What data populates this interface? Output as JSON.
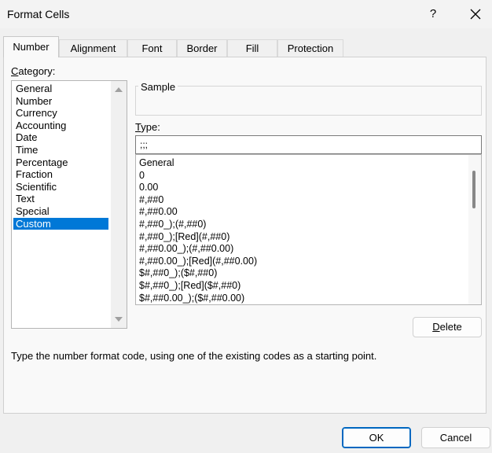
{
  "dialog": {
    "title": "Format Cells",
    "help_label": "?",
    "close_icon": "close-icon"
  },
  "tabs": [
    {
      "label": "Number",
      "active": true
    },
    {
      "label": "Alignment",
      "active": false
    },
    {
      "label": "Font",
      "active": false
    },
    {
      "label": "Border",
      "active": false
    },
    {
      "label": "Fill",
      "active": false
    },
    {
      "label": "Protection",
      "active": false
    }
  ],
  "category": {
    "label_prefix": "C",
    "label_rest": "ategory:",
    "items": [
      "General",
      "Number",
      "Currency",
      "Accounting",
      "Date",
      "Time",
      "Percentage",
      "Fraction",
      "Scientific",
      "Text",
      "Special",
      "Custom"
    ],
    "selected": "Custom"
  },
  "sample": {
    "label": "Sample",
    "value": ""
  },
  "type": {
    "label_prefix": "T",
    "label_rest": "ype:",
    "value": ";;;",
    "formats": [
      "General",
      "0",
      "0.00",
      "#,##0",
      "#,##0.00",
      "#,##0_);(#,##0)",
      "#,##0_);[Red](#,##0)",
      "#,##0.00_);(#,##0.00)",
      "#,##0.00_);[Red](#,##0.00)",
      "$#,##0_);($#,##0)",
      "$#,##0_);[Red]($#,##0)",
      "$#,##0.00_);($#,##0.00)"
    ]
  },
  "buttons": {
    "delete_prefix": "D",
    "delete_rest": "elete",
    "ok": "OK",
    "cancel": "Cancel"
  },
  "hint": "Type the number format code, using one of the existing codes as a starting point.",
  "colors": {
    "selection": "#0078d7",
    "default_button_border": "#0067c0"
  }
}
